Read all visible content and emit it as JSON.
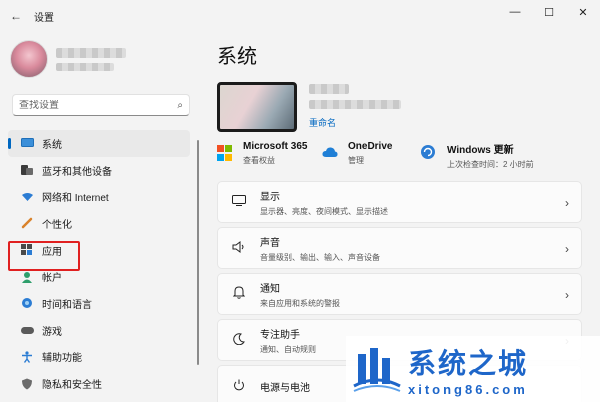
{
  "window": {
    "title": "设置",
    "back": "←",
    "minimize": "—",
    "maximize": "☐",
    "close": "✕"
  },
  "search": {
    "placeholder": "查找设置",
    "icon": "search-icon"
  },
  "sidebar": {
    "items": [
      {
        "label": "系统",
        "icon": "monitor-icon",
        "active": true
      },
      {
        "label": "蓝牙和其他设备",
        "icon": "bluetooth-icon"
      },
      {
        "label": "网络和 Internet",
        "icon": "wifi-icon"
      },
      {
        "label": "个性化",
        "icon": "brush-icon"
      },
      {
        "label": "应用",
        "icon": "apps-icon"
      },
      {
        "label": "帐户",
        "icon": "person-icon"
      },
      {
        "label": "时间和语言",
        "icon": "globe-icon"
      },
      {
        "label": "游戏",
        "icon": "gamepad-icon"
      },
      {
        "label": "辅助功能",
        "icon": "accessibility-icon"
      },
      {
        "label": "隐私和安全性",
        "icon": "shield-icon"
      }
    ]
  },
  "main": {
    "title": "系统",
    "rename": "重命名",
    "tiles": [
      {
        "title": "Microsoft 365",
        "sub": "查看权益"
      },
      {
        "title": "OneDrive",
        "sub": "管理"
      },
      {
        "title": "Windows 更新",
        "sub": "上次检查时间：2 小时前"
      }
    ],
    "cards": [
      {
        "title": "显示",
        "sub": "显示器、亮度、夜间模式、显示描述",
        "icon": "display-icon"
      },
      {
        "title": "声音",
        "sub": "音量级别、输出、输入、声音设备",
        "icon": "speaker-icon"
      },
      {
        "title": "通知",
        "sub": "来自应用和系统的警报",
        "icon": "bell-icon"
      },
      {
        "title": "专注助手",
        "sub": "通知、自动规则",
        "icon": "moon-icon"
      },
      {
        "title": "电源与电池",
        "sub": "",
        "icon": "power-icon"
      }
    ]
  },
  "watermark": {
    "big": "系统之城",
    "small": "xitong86.com"
  },
  "colors": {
    "accent": "#0067c0",
    "highlight": "#e02020",
    "watermark": "#1e66c9"
  }
}
